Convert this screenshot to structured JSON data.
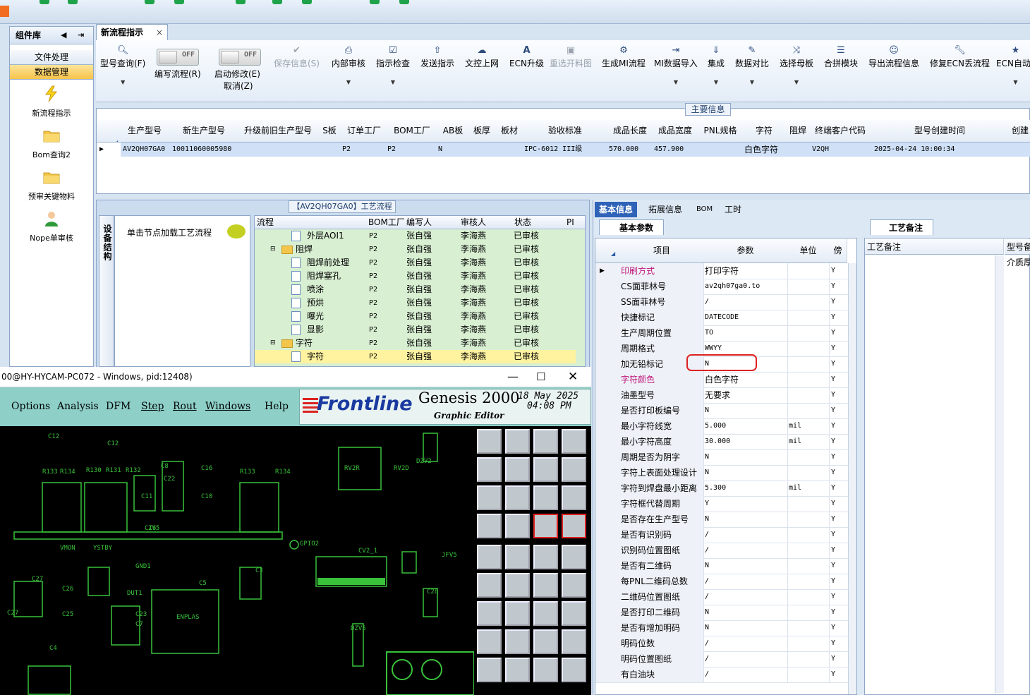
{
  "window": {
    "tab_title": "新流程指示",
    "close_glyph": "×"
  },
  "left_panel": {
    "title": "组件库",
    "sections": [
      {
        "label": "文件处理"
      },
      {
        "label": "数据管理"
      }
    ],
    "items": [
      {
        "label": "新流程指示",
        "icon": "lightning-icon"
      },
      {
        "label": "Bom查询2",
        "icon": "folder-icon"
      },
      {
        "label": "预审关键物料",
        "icon": "folder-icon"
      },
      {
        "label": "Nope单审核",
        "icon": "user-icon"
      }
    ]
  },
  "toolbar": {
    "items": [
      {
        "label": "型号查询(F)",
        "icon": "🔍︎"
      },
      {
        "label": "保存信息(S)",
        "icon": "✔"
      },
      {
        "label": "内部审核",
        "icon": "⎙"
      },
      {
        "label": "指示检查",
        "icon": "☑"
      },
      {
        "label": "发送指示",
        "icon": "⇧"
      },
      {
        "label": "文控上网",
        "icon": "☁"
      },
      {
        "label": "ECN升级",
        "icon": "A"
      },
      {
        "label": "重选开料图",
        "icon": "▣"
      },
      {
        "label": "生成MI流程",
        "icon": "⚙"
      },
      {
        "label": "MI数据导入",
        "icon": "⇥"
      },
      {
        "label": "集成",
        "icon": "⇓"
      },
      {
        "label": "数据对比",
        "icon": "✎"
      },
      {
        "label": "选择母板",
        "icon": "⤨"
      },
      {
        "label": "合拼模块",
        "icon": "☰"
      },
      {
        "label": "导出流程信息",
        "icon": "☺"
      },
      {
        "label": "修复ECN丢流程",
        "icon": "🔧︎"
      },
      {
        "label": "ECN自动_",
        "icon": "★"
      }
    ],
    "toggles": [
      {
        "label": "编写流程(R)",
        "state": "OFF"
      },
      {
        "label": "启动修改(E)",
        "state": "OFF",
        "sub": "取消(Z)"
      }
    ]
  },
  "main_info": {
    "title": "主要信息",
    "columns": [
      "生产型号",
      "新生产型号",
      "升级前旧生产型号",
      "S板",
      "订单工厂",
      "BOM工厂",
      "AB板",
      "板厚",
      "板材",
      "验收标准",
      "成品长度",
      "成品宽度",
      "PNL规格",
      "字符",
      "阻焊",
      "终端客户代码",
      "型号创建时间",
      "创建"
    ],
    "row": [
      "AV2QH07GA0",
      "10011060005980",
      "",
      "",
      "P2",
      "P2",
      "N",
      "",
      "",
      "IPC-6012 III级",
      "570.000",
      "457.900",
      "",
      "白色字符",
      "",
      "V2QH",
      "2025-04-24 10:00:34",
      ""
    ]
  },
  "process": {
    "title": "【AV2QH07GA0】工艺流程",
    "side_tab": "设备结构",
    "hint": "单击节点加载工艺流程",
    "columns": [
      "流程",
      "BOM工厂",
      "编写人",
      "审核人",
      "状态",
      "PI"
    ],
    "rows": [
      {
        "name": "外层AOI1",
        "type": "file",
        "level": 2,
        "factory": "P2",
        "writer": "张自强",
        "reviewer": "李海燕",
        "status": "已审核"
      },
      {
        "name": "阻焊",
        "type": "folder",
        "level": 1,
        "factory": "P2",
        "writer": "张自强",
        "reviewer": "李海燕",
        "status": "已审核"
      },
      {
        "name": "阻焊前处理",
        "type": "file",
        "level": 2,
        "factory": "P2",
        "writer": "张自强",
        "reviewer": "李海燕",
        "status": "已审核"
      },
      {
        "name": "阻焊塞孔",
        "type": "file",
        "level": 2,
        "factory": "P2",
        "writer": "张自强",
        "reviewer": "李海燕",
        "status": "已审核"
      },
      {
        "name": "喷涂",
        "type": "file",
        "level": 2,
        "factory": "P2",
        "writer": "张自强",
        "reviewer": "李海燕",
        "status": "已审核"
      },
      {
        "name": "预烘",
        "type": "file",
        "level": 2,
        "factory": "P2",
        "writer": "张自强",
        "reviewer": "李海燕",
        "status": "已审核"
      },
      {
        "name": "曝光",
        "type": "file",
        "level": 2,
        "factory": "P2",
        "writer": "张自强",
        "reviewer": "李海燕",
        "status": "已审核"
      },
      {
        "name": "显影",
        "type": "file",
        "level": 2,
        "factory": "P2",
        "writer": "张自强",
        "reviewer": "李海燕",
        "status": "已审核"
      },
      {
        "name": "字符",
        "type": "folder",
        "level": 1,
        "factory": "P2",
        "writer": "张自强",
        "reviewer": "李海燕",
        "status": "已审核"
      },
      {
        "name": "字符",
        "type": "file",
        "level": 2,
        "factory": "P2",
        "writer": "张自强",
        "reviewer": "李海燕",
        "status": "已审核",
        "selected": true
      }
    ]
  },
  "right_panel": {
    "tabs": [
      "基本信息",
      "拓展信息",
      "BOM",
      "工时"
    ],
    "basic_tab": "基本参数",
    "remarks_tab": "工艺备注",
    "columns": [
      "项目",
      "参数",
      "单位",
      "傍"
    ],
    "remarks_columns": [
      "工艺备注",
      "型号备"
    ],
    "remarks_cell": "介质厚",
    "params": [
      {
        "k": "印刷方式",
        "v": "打印字符",
        "u": "",
        "b": "Y",
        "pink": true,
        "cur": true
      },
      {
        "k": "CS面菲林号",
        "v": "av2qh07ga0.to",
        "u": "",
        "b": "Y"
      },
      {
        "k": "SS面菲林号",
        "v": "/",
        "u": "",
        "b": "Y"
      },
      {
        "k": "快捷标记",
        "v": "DATECODE",
        "u": "",
        "b": "Y"
      },
      {
        "k": "生产周期位置",
        "v": "TO",
        "u": "",
        "b": "Y"
      },
      {
        "k": "周期格式",
        "v": "WWYY",
        "u": "",
        "b": "Y"
      },
      {
        "k": "加无铅标记",
        "v": "N",
        "u": "",
        "b": "Y"
      },
      {
        "k": "字符颜色",
        "v": "白色字符",
        "u": "",
        "b": "Y",
        "pink": true
      },
      {
        "k": "油墨型号",
        "v": "无要求",
        "u": "",
        "b": "Y"
      },
      {
        "k": "是否打印板编号",
        "v": "N",
        "u": "",
        "b": "Y"
      },
      {
        "k": "最小字符线宽",
        "v": "5.000",
        "u": "mil",
        "b": "Y"
      },
      {
        "k": "最小字符高度",
        "v": "30.000",
        "u": "mil",
        "b": "Y"
      },
      {
        "k": "周期是否为阴字",
        "v": "N",
        "u": "",
        "b": "Y"
      },
      {
        "k": "字符上表面处理设计",
        "v": "N",
        "u": "",
        "b": "Y"
      },
      {
        "k": "字符到焊盘最小距离",
        "v": "5.300",
        "u": "mil",
        "b": "Y"
      },
      {
        "k": "字符框代替周期",
        "v": "Y",
        "u": "",
        "b": "Y"
      },
      {
        "k": "是否存在生产型号",
        "v": "N",
        "u": "",
        "b": "Y"
      },
      {
        "k": "是否有识别码",
        "v": "/",
        "u": "",
        "b": "Y"
      },
      {
        "k": "识别码位置图纸",
        "v": "/",
        "u": "",
        "b": "Y"
      },
      {
        "k": "是否有二维码",
        "v": "N",
        "u": "",
        "b": "Y"
      },
      {
        "k": "每PNL二维码总数",
        "v": "/",
        "u": "",
        "b": "Y"
      },
      {
        "k": "二维码位置图纸",
        "v": "/",
        "u": "",
        "b": "Y"
      },
      {
        "k": "是否打印二维码",
        "v": "N",
        "u": "",
        "b": "Y"
      },
      {
        "k": "是否有增加明码",
        "v": "N",
        "u": "",
        "b": "Y"
      },
      {
        "k": "明码位数",
        "v": "/",
        "u": "",
        "b": "Y"
      },
      {
        "k": "明码位置图纸",
        "v": "/",
        "u": "",
        "b": "Y"
      },
      {
        "k": "有白油块",
        "v": "/",
        "u": "",
        "b": "Y"
      }
    ]
  },
  "genesis": {
    "title": "00@HY-HYCAM-PC072 - Windows, pid:12408)",
    "menu": [
      "Options",
      "Analysis",
      "DFM",
      "Step",
      "Rout",
      "Windows",
      "Help"
    ],
    "logo": "Frontline",
    "product": "Genesis 2000",
    "subtitle": "Graphic Editor",
    "date": "18 May 2025",
    "time": "04:08 PM",
    "canvas_labels": [
      "R133",
      "R134",
      "R130",
      "R131",
      "R132",
      "C12",
      "C8",
      "C16",
      "C22",
      "C10",
      "C11",
      "R133",
      "R134",
      "RV2R",
      "RV2D",
      "DZV2",
      "GPIO2",
      "CV2_1",
      "JFV5",
      "VMON",
      "YSTBY",
      "DUT1",
      "ENPLAS",
      "C23",
      "C7",
      "C27",
      "C26",
      "C25",
      "C28",
      "DZV5",
      "ZV5",
      "GND1",
      "C5",
      "C3",
      "C4",
      "C12",
      "C16",
      "C27"
    ]
  },
  "colors": {
    "accent": "#2f63b8",
    "highlight": "#fff3a0",
    "tree_bg": "#d8efd2",
    "pink": "#c0157a",
    "red_box": "#dd2222"
  }
}
